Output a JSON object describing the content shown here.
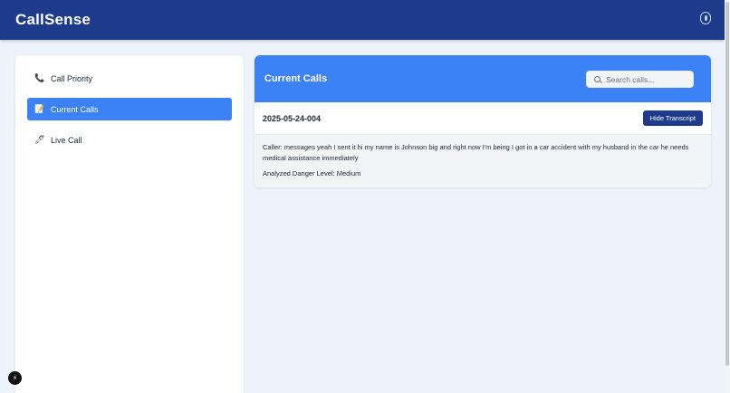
{
  "app": {
    "title": "CallSense"
  },
  "sidebar": {
    "items": [
      {
        "label": "Call Priority",
        "icon": "phone-icon"
      },
      {
        "label": "Current Calls",
        "icon": "memo-icon",
        "active": true
      },
      {
        "label": "Live Call",
        "icon": "pen-icon"
      }
    ]
  },
  "main": {
    "title": "Current Calls",
    "search": {
      "placeholder": "Search calls...",
      "value": ""
    },
    "call": {
      "id": "2025-05-24-004",
      "toggle_label": "Hide Transcript",
      "transcript": "Caller: messages yeah I sent it hi my name is Johnson big and right now I'm being I got in a car accident with my husband in the car he needs medical assistance immediately",
      "danger_level": "Analyzed Danger Level: Medium"
    }
  },
  "colors": {
    "header_bg": "#1e3a8a",
    "accent": "#3b82f6",
    "page_bg": "#eef3fb"
  }
}
